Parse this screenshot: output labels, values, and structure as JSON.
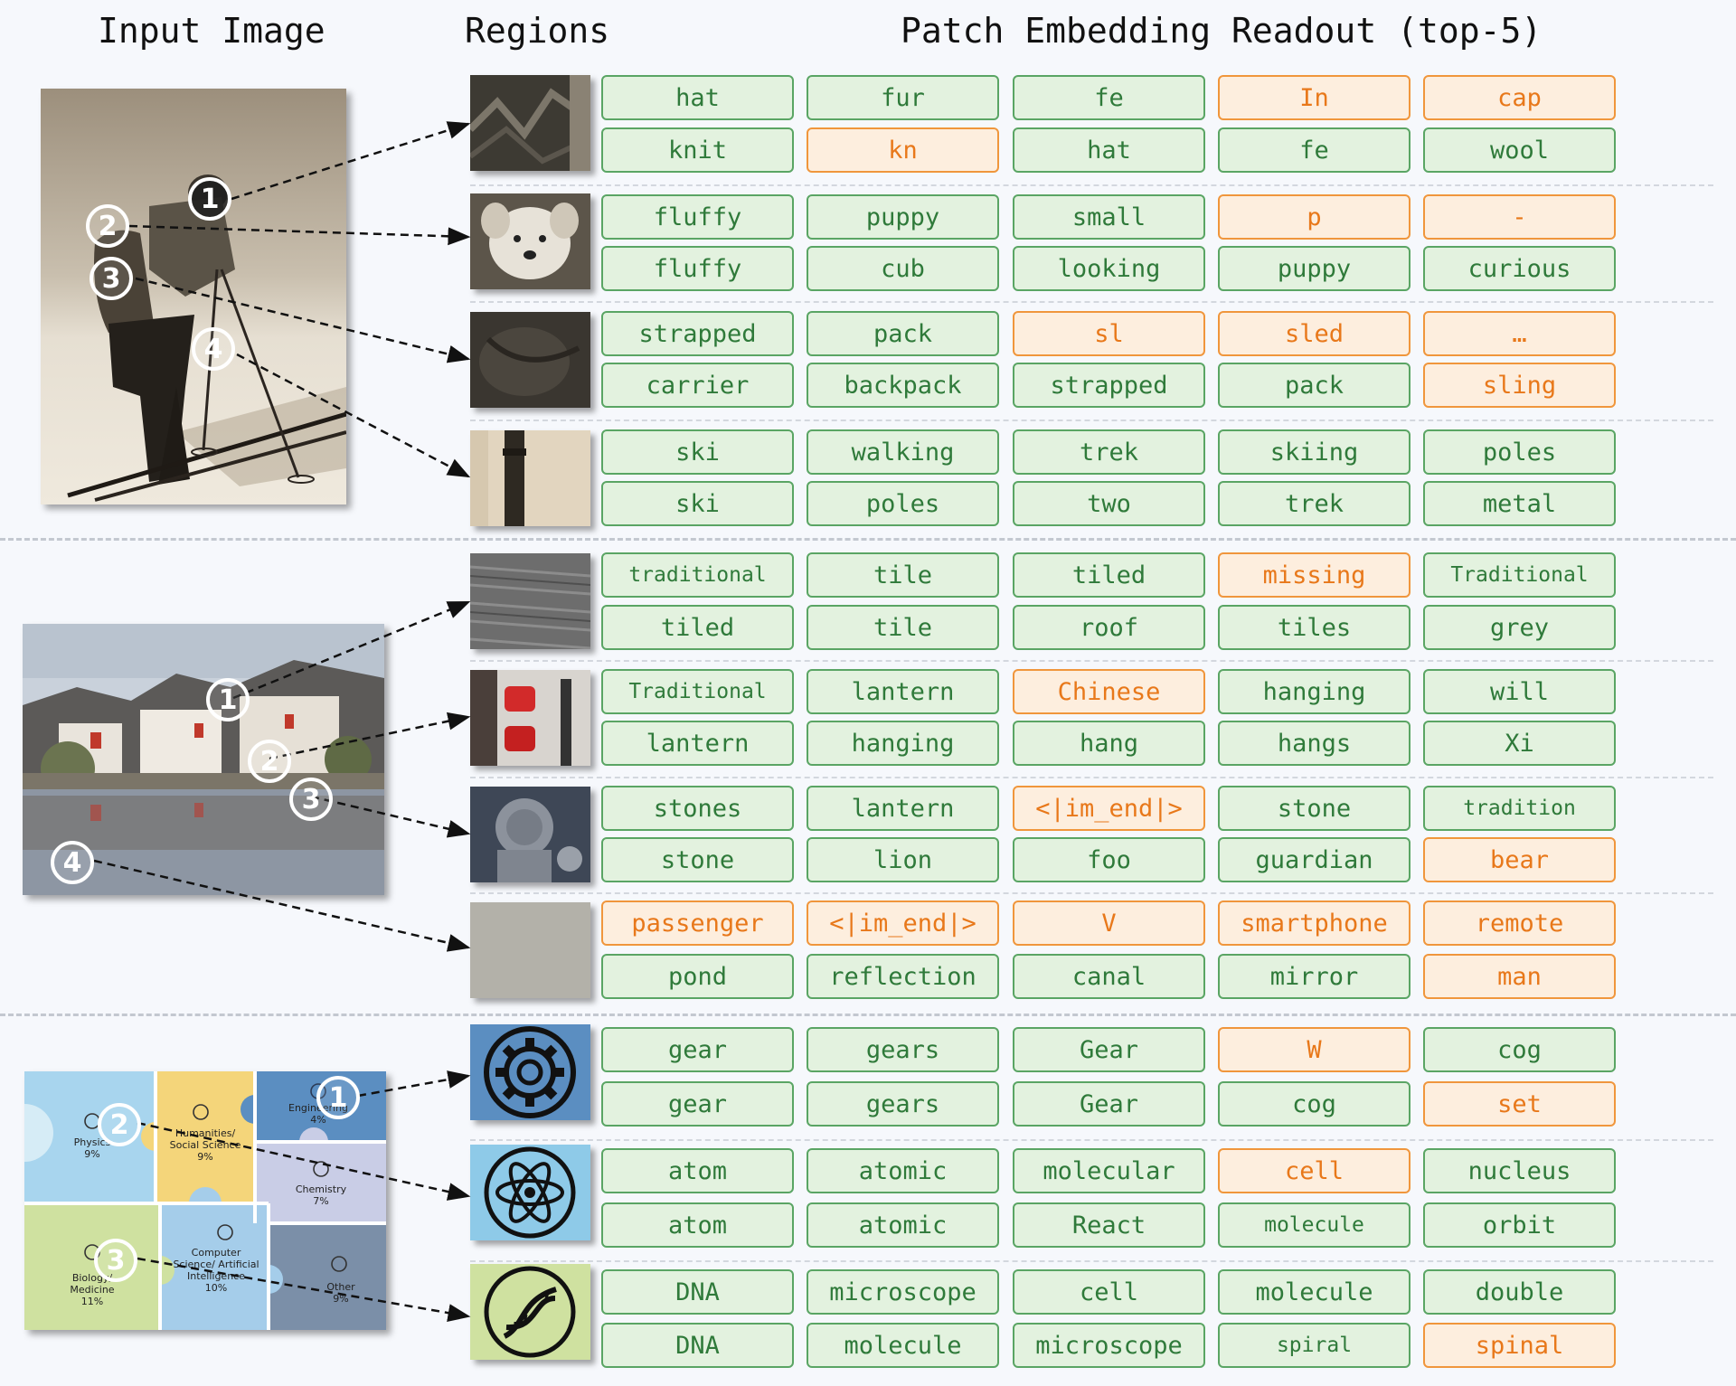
{
  "headers": {
    "input_image": "Input Image",
    "regions": "Regions",
    "readout": "Patch Embedding Readout (top-5)"
  },
  "colors": {
    "good_fill": "#e3f2df",
    "good_border": "#5aa564",
    "good_text": "#2f7a3a",
    "bad_fill": "#fdeede",
    "bad_border": "#f0963c",
    "bad_text": "#e8781a"
  },
  "markers": [
    "1",
    "2",
    "3",
    "4"
  ],
  "field_puzzle": {
    "pieces": [
      {
        "label": "Engineering",
        "pct": "4%",
        "color": "#5b8ec1",
        "icon": "gear-icon"
      },
      {
        "label": "Physics",
        "pct": "9%",
        "color": "#a8d5ee",
        "icon": "atom-icon"
      },
      {
        "label": "Humanities/ Social Science",
        "pct": "9%",
        "color": "#f4d57a",
        "icon": "person-icon"
      },
      {
        "label": "Chemistry",
        "pct": "7%",
        "color": "#c9cde6",
        "icon": "flask-icon"
      },
      {
        "label": "Biology/ Medicine",
        "pct": "11%",
        "color": "#cfe1a0",
        "icon": "dna-icon"
      },
      {
        "label": "Computer Science/ Artificial Intelligence",
        "pct": "10%",
        "color": "#a5cdea",
        "icon": "sparkle-icon"
      },
      {
        "label": "Other",
        "pct": "9%",
        "color": "#7b8fa8",
        "icon": "list-icon"
      }
    ]
  },
  "groups": [
    {
      "image": "skier",
      "regions": [
        {
          "marker": "1",
          "thumb": "hat-knit-icon",
          "rows": [
            [
              {
                "t": "hat",
                "ok": true
              },
              {
                "t": "fur",
                "ok": true
              },
              {
                "t": "fe",
                "ok": true
              },
              {
                "t": "In",
                "ok": false
              },
              {
                "t": "cap",
                "ok": false
              }
            ],
            [
              {
                "t": "knit",
                "ok": true
              },
              {
                "t": "kn",
                "ok": false
              },
              {
                "t": "hat",
                "ok": true
              },
              {
                "t": "fe",
                "ok": true
              },
              {
                "t": "wool",
                "ok": true
              }
            ]
          ]
        },
        {
          "marker": "2",
          "thumb": "puppy-icon",
          "rows": [
            [
              {
                "t": "fluffy",
                "ok": true
              },
              {
                "t": "puppy",
                "ok": true
              },
              {
                "t": "small",
                "ok": true
              },
              {
                "t": "p",
                "ok": false
              },
              {
                "t": "-",
                "ok": false
              }
            ],
            [
              {
                "t": "fluffy",
                "ok": true
              },
              {
                "t": "cub",
                "ok": true
              },
              {
                "t": "looking",
                "ok": true
              },
              {
                "t": "puppy",
                "ok": true
              },
              {
                "t": "curious",
                "ok": true
              }
            ]
          ]
        },
        {
          "marker": "3",
          "thumb": "pack-icon",
          "rows": [
            [
              {
                "t": "strapped",
                "ok": true
              },
              {
                "t": "pack",
                "ok": true
              },
              {
                "t": "sl",
                "ok": false
              },
              {
                "t": "sled",
                "ok": false
              },
              {
                "t": "…",
                "ok": false
              }
            ],
            [
              {
                "t": "carrier",
                "ok": true
              },
              {
                "t": "backpack",
                "ok": true
              },
              {
                "t": "strapped",
                "ok": true
              },
              {
                "t": "pack",
                "ok": true
              },
              {
                "t": "sling",
                "ok": false
              }
            ]
          ]
        },
        {
          "marker": "4",
          "thumb": "pole-icon",
          "rows": [
            [
              {
                "t": "ski",
                "ok": true
              },
              {
                "t": "walking",
                "ok": true
              },
              {
                "t": "trek",
                "ok": true
              },
              {
                "t": "skiing",
                "ok": true
              },
              {
                "t": "poles",
                "ok": true
              }
            ],
            [
              {
                "t": "ski",
                "ok": true
              },
              {
                "t": "poles",
                "ok": true
              },
              {
                "t": "two",
                "ok": true
              },
              {
                "t": "trek",
                "ok": true
              },
              {
                "t": "metal",
                "ok": true
              }
            ]
          ]
        }
      ]
    },
    {
      "image": "village",
      "regions": [
        {
          "marker": "1",
          "thumb": "roof-tile-icon",
          "rows": [
            [
              {
                "t": "traditional",
                "ok": true,
                "s": true
              },
              {
                "t": "tile",
                "ok": true
              },
              {
                "t": "tiled",
                "ok": true
              },
              {
                "t": "missing",
                "ok": false
              },
              {
                "t": "Traditional",
                "ok": true,
                "s": true
              }
            ],
            [
              {
                "t": "tiled",
                "ok": true
              },
              {
                "t": "tile",
                "ok": true
              },
              {
                "t": "roof",
                "ok": true
              },
              {
                "t": "tiles",
                "ok": true
              },
              {
                "t": "grey",
                "ok": true
              }
            ]
          ]
        },
        {
          "marker": "2",
          "thumb": "lantern-icon",
          "rows": [
            [
              {
                "t": "Traditional",
                "ok": true,
                "s": true
              },
              {
                "t": "lantern",
                "ok": true
              },
              {
                "t": "Chinese",
                "ok": false
              },
              {
                "t": "hanging",
                "ok": true
              },
              {
                "t": "will",
                "ok": true
              }
            ],
            [
              {
                "t": "lantern",
                "ok": true
              },
              {
                "t": "hanging",
                "ok": true
              },
              {
                "t": "hang",
                "ok": true
              },
              {
                "t": "hangs",
                "ok": true
              },
              {
                "t": "Xi",
                "ok": true
              }
            ]
          ]
        },
        {
          "marker": "3",
          "thumb": "stone-lion-icon",
          "rows": [
            [
              {
                "t": "stones",
                "ok": true
              },
              {
                "t": "lantern",
                "ok": true
              },
              {
                "t": "<|im_end|>",
                "ok": false
              },
              {
                "t": "stone",
                "ok": true
              },
              {
                "t": "tradition",
                "ok": true,
                "s": true
              }
            ],
            [
              {
                "t": "stone",
                "ok": true
              },
              {
                "t": "lion",
                "ok": true
              },
              {
                "t": "foo",
                "ok": true
              },
              {
                "t": "guardian",
                "ok": true
              },
              {
                "t": "bear",
                "ok": false
              }
            ]
          ]
        },
        {
          "marker": "4",
          "thumb": "water-icon",
          "rows": [
            [
              {
                "t": "passenger",
                "ok": false
              },
              {
                "t": "<|im_end|>",
                "ok": false
              },
              {
                "t": "V",
                "ok": false
              },
              {
                "t": "smartphone",
                "ok": false
              },
              {
                "t": "remote",
                "ok": false
              }
            ],
            [
              {
                "t": "pond",
                "ok": true
              },
              {
                "t": "reflection",
                "ok": true
              },
              {
                "t": "canal",
                "ok": true
              },
              {
                "t": "mirror",
                "ok": true
              },
              {
                "t": "man",
                "ok": false
              }
            ]
          ]
        }
      ]
    },
    {
      "image": "puzzle",
      "regions": [
        {
          "marker": "1",
          "thumb": "gear-icon",
          "rows": [
            [
              {
                "t": "gear",
                "ok": true
              },
              {
                "t": "gears",
                "ok": true
              },
              {
                "t": "Gear",
                "ok": true
              },
              {
                "t": "W",
                "ok": false
              },
              {
                "t": "cog",
                "ok": true
              }
            ],
            [
              {
                "t": "gear",
                "ok": true
              },
              {
                "t": "gears",
                "ok": true
              },
              {
                "t": "Gear",
                "ok": true
              },
              {
                "t": "cog",
                "ok": true
              },
              {
                "t": "set",
                "ok": false
              }
            ]
          ]
        },
        {
          "marker": "2",
          "thumb": "atom-icon",
          "rows": [
            [
              {
                "t": "atom",
                "ok": true
              },
              {
                "t": "atomic",
                "ok": true
              },
              {
                "t": "molecular",
                "ok": true
              },
              {
                "t": "cell",
                "ok": false
              },
              {
                "t": "nucleus",
                "ok": true
              }
            ],
            [
              {
                "t": "atom",
                "ok": true
              },
              {
                "t": "atomic",
                "ok": true
              },
              {
                "t": "React",
                "ok": true
              },
              {
                "t": "molecule",
                "ok": true,
                "s": true
              },
              {
                "t": "orbit",
                "ok": true
              }
            ]
          ]
        },
        {
          "marker": "3",
          "thumb": "dna-icon",
          "rows": [
            [
              {
                "t": "DNA",
                "ok": true
              },
              {
                "t": "microscope",
                "ok": true
              },
              {
                "t": "cell",
                "ok": true
              },
              {
                "t": "molecule",
                "ok": true
              },
              {
                "t": "double",
                "ok": true
              }
            ],
            [
              {
                "t": "DNA",
                "ok": true
              },
              {
                "t": "molecule",
                "ok": true
              },
              {
                "t": "microscope",
                "ok": true
              },
              {
                "t": "spiral",
                "ok": true,
                "s": true
              },
              {
                "t": "spinal",
                "ok": false
              }
            ]
          ]
        }
      ]
    }
  ]
}
